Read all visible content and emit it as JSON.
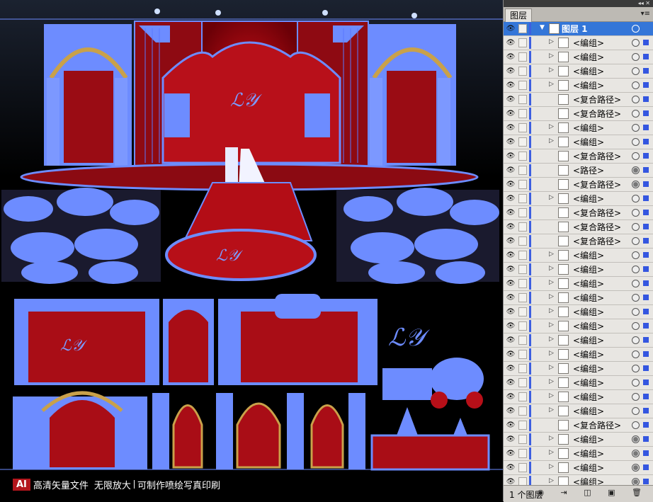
{
  "canvas": {
    "footer": {
      "badge": "AI",
      "title": "高清矢量文件",
      "part1": "无限放大",
      "part2": "可制作喷绘写真印刷"
    }
  },
  "panel": {
    "tab_label": "图层",
    "menu_icon": "panel-menu-icon",
    "top_layer": {
      "name": "图层 1"
    },
    "rows": [
      {
        "label": "<编组>",
        "expand": true,
        "target_filled": false
      },
      {
        "label": "<编组>",
        "expand": true,
        "target_filled": false
      },
      {
        "label": "<编组>",
        "expand": true,
        "target_filled": false
      },
      {
        "label": "<编组>",
        "expand": true,
        "target_filled": false
      },
      {
        "label": "<复合路径>",
        "expand": false,
        "target_filled": false
      },
      {
        "label": "<复合路径>",
        "expand": false,
        "target_filled": false
      },
      {
        "label": "<编组>",
        "expand": true,
        "target_filled": false
      },
      {
        "label": "<编组>",
        "expand": true,
        "target_filled": false
      },
      {
        "label": "<复合路径>",
        "expand": false,
        "target_filled": false
      },
      {
        "label": "<路径>",
        "expand": false,
        "target_filled": true
      },
      {
        "label": "<复合路径>",
        "expand": false,
        "target_filled": true
      },
      {
        "label": "<编组>",
        "expand": true,
        "target_filled": false
      },
      {
        "label": "<复合路径>",
        "expand": false,
        "target_filled": false
      },
      {
        "label": "<复合路径>",
        "expand": false,
        "target_filled": false
      },
      {
        "label": "<复合路径>",
        "expand": false,
        "target_filled": false
      },
      {
        "label": "<编组>",
        "expand": true,
        "target_filled": false
      },
      {
        "label": "<编组>",
        "expand": true,
        "target_filled": false
      },
      {
        "label": "<编组>",
        "expand": true,
        "target_filled": false
      },
      {
        "label": "<编组>",
        "expand": true,
        "target_filled": false
      },
      {
        "label": "<编组>",
        "expand": true,
        "target_filled": false
      },
      {
        "label": "<编组>",
        "expand": true,
        "target_filled": false
      },
      {
        "label": "<编组>",
        "expand": true,
        "target_filled": false
      },
      {
        "label": "<编组>",
        "expand": true,
        "target_filled": false
      },
      {
        "label": "<编组>",
        "expand": true,
        "target_filled": false
      },
      {
        "label": "<编组>",
        "expand": true,
        "target_filled": false
      },
      {
        "label": "<编组>",
        "expand": true,
        "target_filled": false
      },
      {
        "label": "<编组>",
        "expand": true,
        "target_filled": false
      },
      {
        "label": "<复合路径>",
        "expand": false,
        "target_filled": false
      },
      {
        "label": "<编组>",
        "expand": true,
        "target_filled": true
      },
      {
        "label": "<编组>",
        "expand": true,
        "target_filled": true
      },
      {
        "label": "<编组>",
        "expand": true,
        "target_filled": true
      },
      {
        "label": "<编组>",
        "expand": true,
        "target_filled": true
      }
    ],
    "footer": {
      "count": "1 个图层"
    }
  }
}
